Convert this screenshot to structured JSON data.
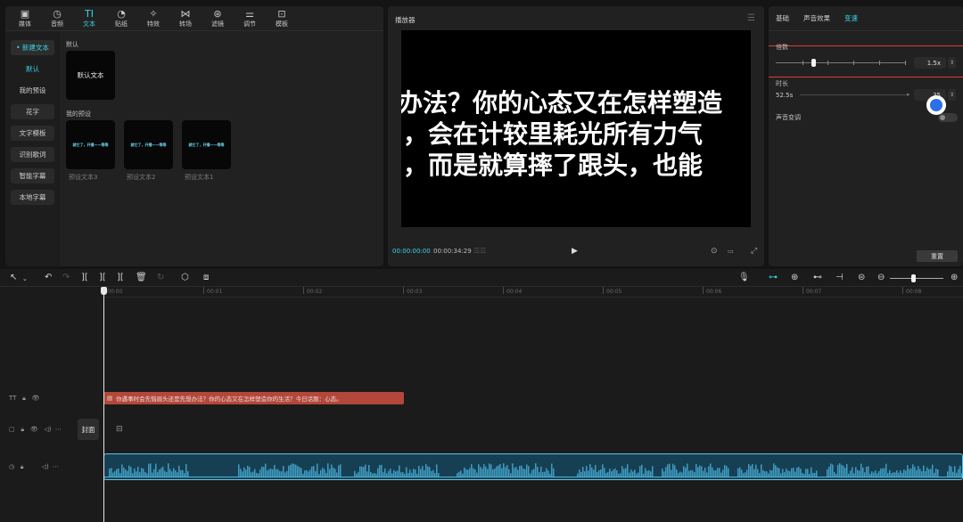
{
  "left_panel": {
    "tabs": [
      {
        "label": "媒体",
        "icon": "media-icon",
        "glyph": "▣"
      },
      {
        "label": "音频",
        "icon": "audio-icon",
        "glyph": "◷"
      },
      {
        "label": "文本",
        "icon": "text-icon",
        "glyph": "TI"
      },
      {
        "label": "贴纸",
        "icon": "sticker-icon",
        "glyph": "◔"
      },
      {
        "label": "特效",
        "icon": "effects-icon",
        "glyph": "✧"
      },
      {
        "label": "转场",
        "icon": "transition-icon",
        "glyph": "⋈"
      },
      {
        "label": "滤镜",
        "icon": "filter-icon",
        "glyph": "⊛"
      },
      {
        "label": "调节",
        "icon": "adjust-icon",
        "glyph": "⚌"
      },
      {
        "label": "模板",
        "icon": "template-icon",
        "glyph": "⊡"
      }
    ],
    "active_tab": "文本",
    "sidebar": [
      "• 新建文本",
      "默认",
      "我的预设",
      "花字",
      "文字模板",
      "识别歌词",
      "智能字幕",
      "本地字幕"
    ],
    "section_default": "默认",
    "default_card": "默认文本",
    "section_presets": "我的预设",
    "preset_card_text": "就它了，开播——等等",
    "presets": [
      "预设文本3",
      "预设文本2",
      "预设文本1"
    ]
  },
  "player": {
    "title": "播放器",
    "subtitle_lines": [
      "办法？你的心态又在怎样塑造",
      "，会在计较里耗光所有力气",
      "，而是就算摔了跟头，也能"
    ],
    "current_time": "00:00:00:00",
    "total_time": "00:00:34:29"
  },
  "right_panel": {
    "tabs": [
      "基础",
      "声音效果",
      "变速"
    ],
    "active_tab": "变速",
    "speed_label": "倍数",
    "speed_value": "1.5x",
    "speed_fraction": 0.4,
    "duration_label": "时长",
    "duration_from": "52.5s",
    "duration_to": "35",
    "pitch_label": "声音变调",
    "reset_label": "重置"
  },
  "timeline": {
    "ruler": [
      "00:00",
      "00:01",
      "00:02",
      "00:03",
      "00:04",
      "00:05",
      "00:06",
      "00:07",
      "00:08"
    ],
    "text_clip": "你遇事时会先恼眉头还是先想办法？你的心态又在怎样塑造你的生活？今日话题：心态。",
    "cover_label": "封面"
  },
  "colors": {
    "accent": "#39d4e6",
    "text_clip": "#b2473a",
    "audio_clip": "#173f53",
    "highlight": "#e03a3a"
  }
}
